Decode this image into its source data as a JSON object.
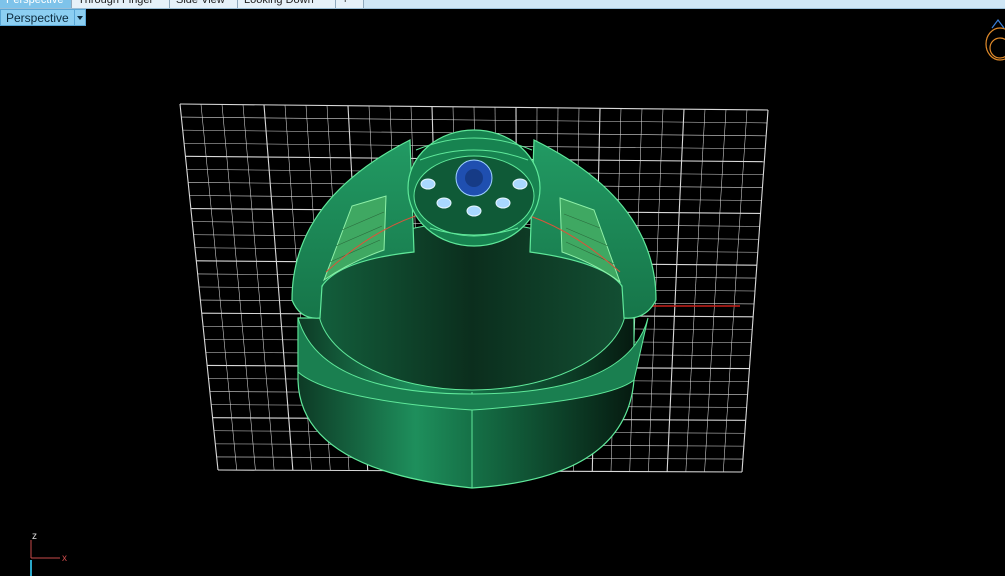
{
  "tabs": [
    {
      "label": "Perspective"
    },
    {
      "label": "Through Finger"
    },
    {
      "label": "Side View"
    },
    {
      "label": "Looking Down"
    },
    {
      "label": "+"
    }
  ],
  "viewport": {
    "name": "Perspective"
  },
  "axis": {
    "z_label": "z",
    "x_label": "x"
  },
  "colors": {
    "background": "#000000",
    "grid": "#d9d9d9",
    "model": "#1d8a5a",
    "model_edge": "#5fe89a",
    "accent_blue": "#1f4fb0",
    "gem": "#a9d8ff",
    "x_axis": "#c8211b",
    "y_axis": "#2aa7c9"
  },
  "icons": {
    "nav_cube": "ring-preview-icon",
    "dropdown": "chevron-down-icon"
  }
}
